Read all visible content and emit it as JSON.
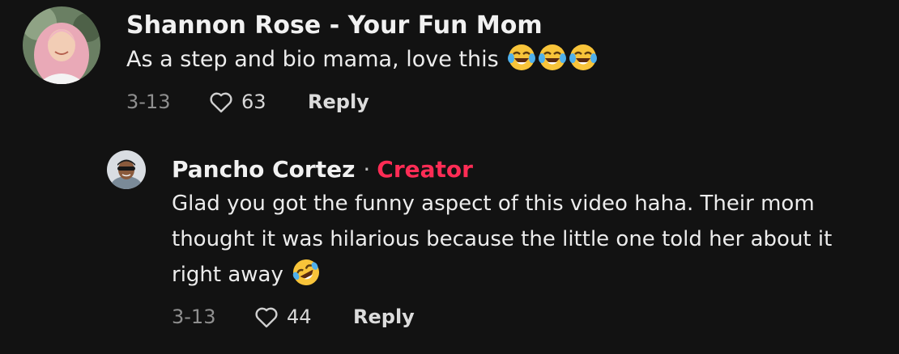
{
  "comments": [
    {
      "author": "Shannon Rose - Your Fun Mom",
      "text": "As a step and bio mama, love this",
      "emoji": [
        "tears-of-joy-emoji",
        "tears-of-joy-emoji",
        "tears-of-joy-emoji"
      ],
      "date": "3-13",
      "likes": "63",
      "reply_label": "Reply"
    },
    {
      "author": "Pancho Cortez",
      "separator": "·",
      "badge": "Creator",
      "text": "Glad you got the funny aspect of this video haha. Their mom thought it was hilarious because the little one told her about it right away",
      "emoji": [
        "rolling-on-floor-laughing-emoji"
      ],
      "date": "3-13",
      "likes": "44",
      "reply_label": "Reply"
    }
  ],
  "colors": {
    "background": "#121212",
    "creator_badge": "#fe2c55",
    "text": "#ececec",
    "muted": "#8f8f8f"
  }
}
